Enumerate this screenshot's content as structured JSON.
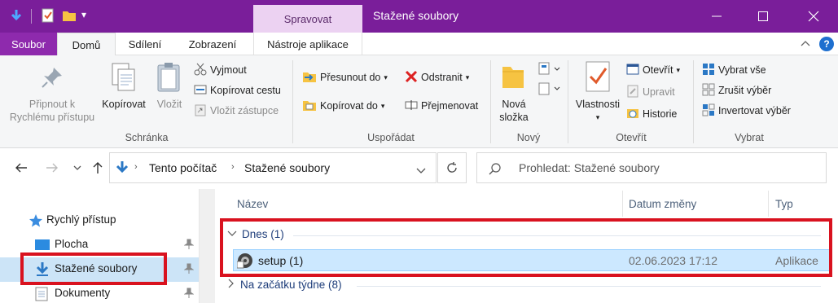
{
  "titlebar": {
    "contextual_tab": "Spravovat",
    "title": "Stažené soubory",
    "qat_dropdown": "▾"
  },
  "tabs": [
    "Soubor",
    "Domů",
    "Sdílení",
    "Zobrazení",
    "Nástroje aplikace"
  ],
  "ribbon": {
    "clipboard": {
      "pin_label_1": "Připnout k",
      "pin_label_2": "Rychlému přístupu",
      "copy": "Kopírovat",
      "paste": "Vložit",
      "cut": "Vyjmout",
      "copy_path": "Kopírovat cestu",
      "paste_shortcut": "Vložit zástupce",
      "group": "Schránka"
    },
    "organize": {
      "move_to": "Přesunout do",
      "copy_to": "Kopírovat do",
      "delete": "Odstranit",
      "rename": "Přejmenovat",
      "group": "Uspořádat"
    },
    "new": {
      "new_folder_1": "Nová",
      "new_folder_2": "složka",
      "group": "Nový"
    },
    "open": {
      "properties": "Vlastnosti",
      "open": "Otevřít",
      "edit": "Upravit",
      "history": "Historie",
      "group": "Otevřít"
    },
    "select": {
      "select_all": "Vybrat vše",
      "select_none": "Zrušit výběr",
      "invert": "Invertovat výběr",
      "group": "Vybrat"
    }
  },
  "address": {
    "crumb_1": "Tento počítač",
    "crumb_2": "Stažené soubory",
    "search_placeholder": "Prohledat: Stažené soubory"
  },
  "nav_pane": {
    "items": [
      {
        "label": "Rychlý přístup"
      },
      {
        "label": "Plocha"
      },
      {
        "label": "Stažené soubory"
      },
      {
        "label": "Dokumenty"
      }
    ]
  },
  "columns": {
    "name": "Název",
    "date": "Datum změny",
    "type": "Typ"
  },
  "groups": {
    "today": "Dnes (1)",
    "week": "Na začátku týdne (8)"
  },
  "files": [
    {
      "name": "setup (1)",
      "date": "02.06.2023 17:12",
      "type": "Aplikace"
    }
  ],
  "colors": {
    "titlebar": "#7a1e9a",
    "highlight": "#d9121f",
    "selection": "#cce8ff"
  }
}
